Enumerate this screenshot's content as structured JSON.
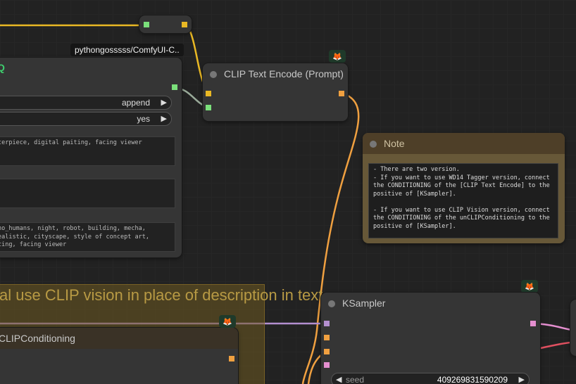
{
  "tag": {
    "text": "pythongosssss/ComfyUI-C.."
  },
  "top_node": {
    "glyph": "Q"
  },
  "left_node": {
    "widget1": {
      "value": "append",
      "arrow": "▶"
    },
    "widget2": {
      "value": "yes",
      "arrow": "▶"
    },
    "text1": "terpiece, digital paiting, facing viewer",
    "text2": "",
    "text3": "no_humans, night, robot, building, mecha,\nealistic, cityscape, style of concept art,\ncing, facing viewer"
  },
  "clip_node": {
    "title": "CLIP Text Encode (Prompt)"
  },
  "note": {
    "title": "Note",
    "text": "- There are two version.\n- If you want to use WD14 Tagger version, connect\nthe CONDITIONING of the [CLIP Text Encode] to the\npositive of [KSampler].\n\n- If you want to use CLIP Vision version, connect\nthe CONDITIONING of the unCLIPConditioning to the\npositive of [KSampler]."
  },
  "group": {
    "title": "al use CLIP vision in place of description in text..."
  },
  "unclip_node": {
    "title": "CLIPConditioning"
  },
  "ksampler": {
    "title": "KSampler",
    "seed_label": "seed",
    "seed_value": "409269831590209",
    "arrow_left": "◀",
    "arrow_right": "▶"
  },
  "badges": {
    "icon": "fox-icon",
    "glyph": "🦊"
  },
  "colors": {
    "clip_wire": "#e9b824",
    "conditioning_wire": "#f0a040",
    "model_wire": "#b48fd0",
    "latent_wire": "#e58fd0",
    "vae_wire": "#e05060",
    "string_wire": "#99aa99"
  }
}
